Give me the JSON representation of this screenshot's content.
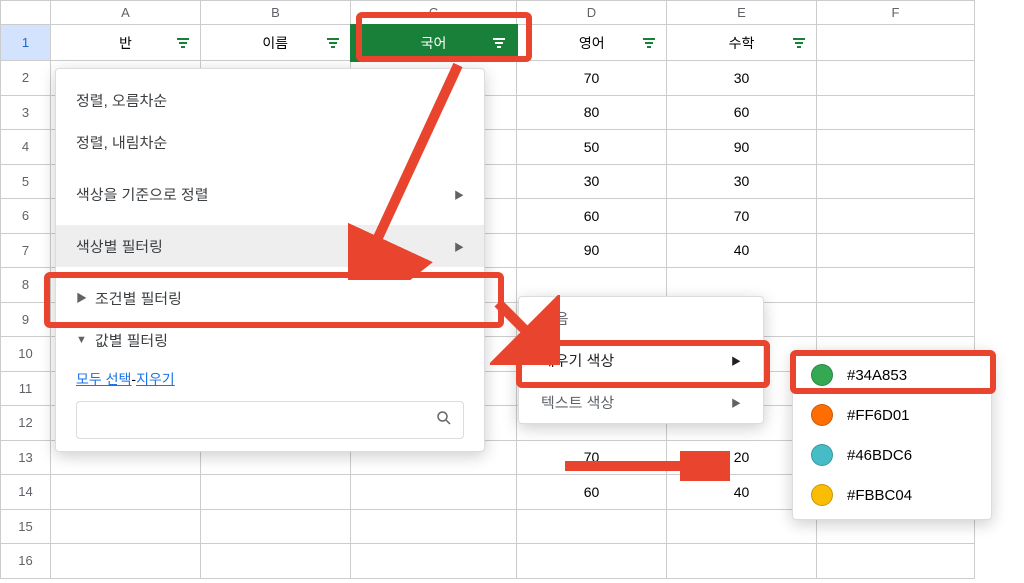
{
  "columns": [
    "A",
    "B",
    "C",
    "D",
    "E",
    "F"
  ],
  "rows": [
    "1",
    "2",
    "3",
    "4",
    "5",
    "6",
    "7",
    "8",
    "9",
    "10",
    "11",
    "12",
    "13",
    "14",
    "15",
    "16"
  ],
  "headers": {
    "A": "반",
    "B": "이름",
    "C": "국어",
    "D": "영어",
    "E": "수학"
  },
  "data": {
    "D": {
      "2": "70",
      "3": "80",
      "4": "50",
      "5": "30",
      "6": "60",
      "7": "90",
      "13": "70",
      "14": "60"
    },
    "E": {
      "2": "30",
      "3": "60",
      "4": "90",
      "5": "30",
      "6": "70",
      "7": "40",
      "13": "20",
      "14": "40"
    }
  },
  "row_edge_colors": {
    "2": "#FF6D01",
    "3": "#46BDC6",
    "7": "#FBBC04"
  },
  "menu": {
    "sort_asc": "정렬, 오름차순",
    "sort_desc": "정렬, 내림차순",
    "sort_by_color": "색상을 기준으로 정렬",
    "filter_by_color": "색상별 필터링",
    "filter_by_condition": "조건별 필터링",
    "filter_by_values": "값별 필터링",
    "select_all": "모두 선택",
    "clear": "지우기",
    "search_placeholder": ""
  },
  "submenu": {
    "none": "없음",
    "fill_color": "채우기 색상",
    "text_color": "텍스트 색상"
  },
  "colors": [
    {
      "hex": "#34A853",
      "label": "#34A853"
    },
    {
      "hex": "#FF6D01",
      "label": "#FF6D01"
    },
    {
      "hex": "#46BDC6",
      "label": "#46BDC6"
    },
    {
      "hex": "#FBBC04",
      "label": "#FBBC04"
    }
  ]
}
